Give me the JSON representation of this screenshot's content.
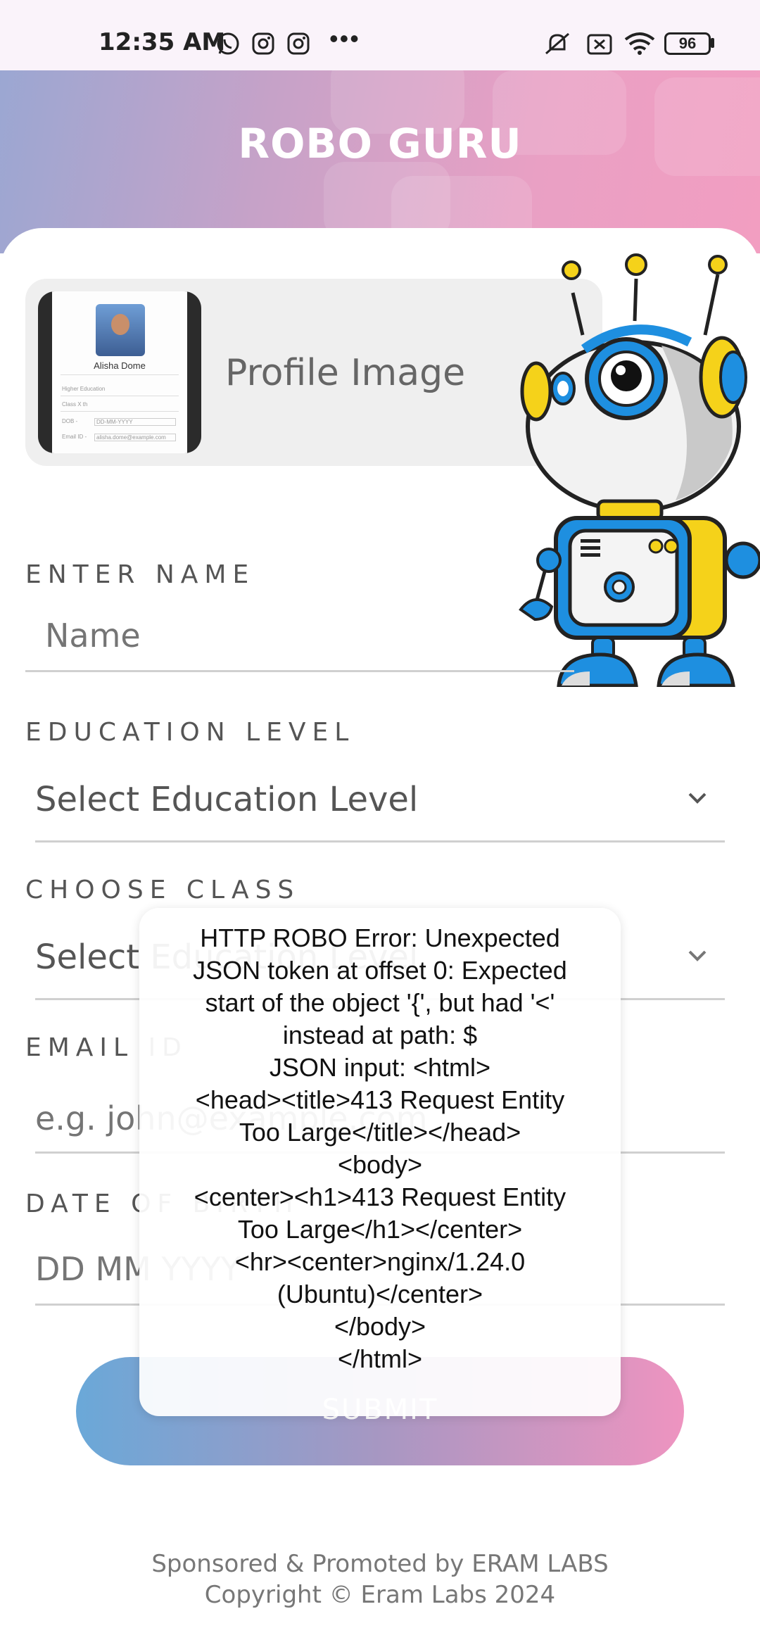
{
  "status_bar": {
    "time": "12:35 AM",
    "battery": "96",
    "icons": [
      "whatsapp-icon",
      "instagram-icon",
      "instagram-icon",
      "more-dots-icon",
      "mute-icon",
      "sim-off-icon",
      "wifi-icon",
      "battery-icon"
    ]
  },
  "header": {
    "title": "ROBO GURU"
  },
  "profile": {
    "label": "Profile Image",
    "thumb_name": "Alisha Dome",
    "thumb_lines": [
      "Higher Education",
      "Class X th",
      "DOB -",
      "Email ID -"
    ],
    "thumb_dob": "DD-MM-YYYY",
    "thumb_email": "alisha.dome@example.com"
  },
  "form": {
    "name_label": "ENTER NAME",
    "name_placeholder": "Name",
    "education_label": "EDUCATION LEVEL",
    "education_value": "Select Education Level",
    "class_label": "CHOOSE CLASS",
    "class_value": "Select Education Level",
    "email_label": "EMAIL ID",
    "email_placeholder": "e.g. john@example.com",
    "dob_label": "DATE OF BIRTH",
    "dob_placeholder": "DD MM YYYY",
    "submit_label": "SUBMIT"
  },
  "footer": {
    "line1": "Sponsored & Promoted by ERAM LABS",
    "line2": "Copyright © Eram Labs 2024"
  },
  "toast": {
    "lines": [
      "HTTP ROBO Error: Unexpected",
      "JSON token at offset 0: Expected",
      "start of the object '{', but had '<'",
      "instead at path: $",
      "JSON input: <html>",
      "<head><title>413 Request Entity",
      "Too Large</title></head>",
      "<body>",
      "<center><h1>413 Request Entity",
      "Too Large</h1></center>",
      "<hr><center>nginx/1.24.0",
      "(Ubuntu)</center>",
      "</body>",
      "</html>"
    ]
  },
  "colors": {
    "header_start": "#9ba7d2",
    "header_end": "#f29ec1",
    "button_start": "#6aa8d8",
    "button_end": "#ee94c0"
  }
}
